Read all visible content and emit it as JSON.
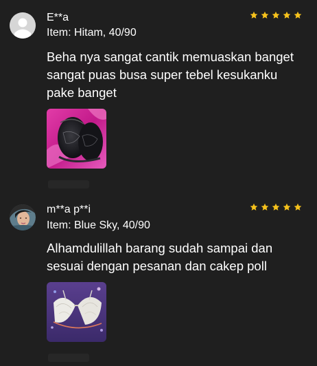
{
  "reviews": [
    {
      "name": "E**a",
      "item": "Item: Hitam, 40/90",
      "rating": 5,
      "text": "Beha nya sangat cantik memuaskan banget sangat puas busa super tebel kesukanku pake banget",
      "avatar": "default-user-icon",
      "photo": "black-lace-bra-photo"
    },
    {
      "name": "m**a p**i",
      "item": "Item: Blue Sky, 40/90",
      "rating": 5,
      "text": "Alhamdulillah barang sudah sampai dan sesuai dengan pesanan dan cakep poll",
      "avatar": "user-photo-avatar",
      "photo": "white-lace-bra-photo"
    }
  ],
  "colors": {
    "background": "#1f1f1f",
    "text": "#ffffff",
    "star": "#f6c21c"
  }
}
